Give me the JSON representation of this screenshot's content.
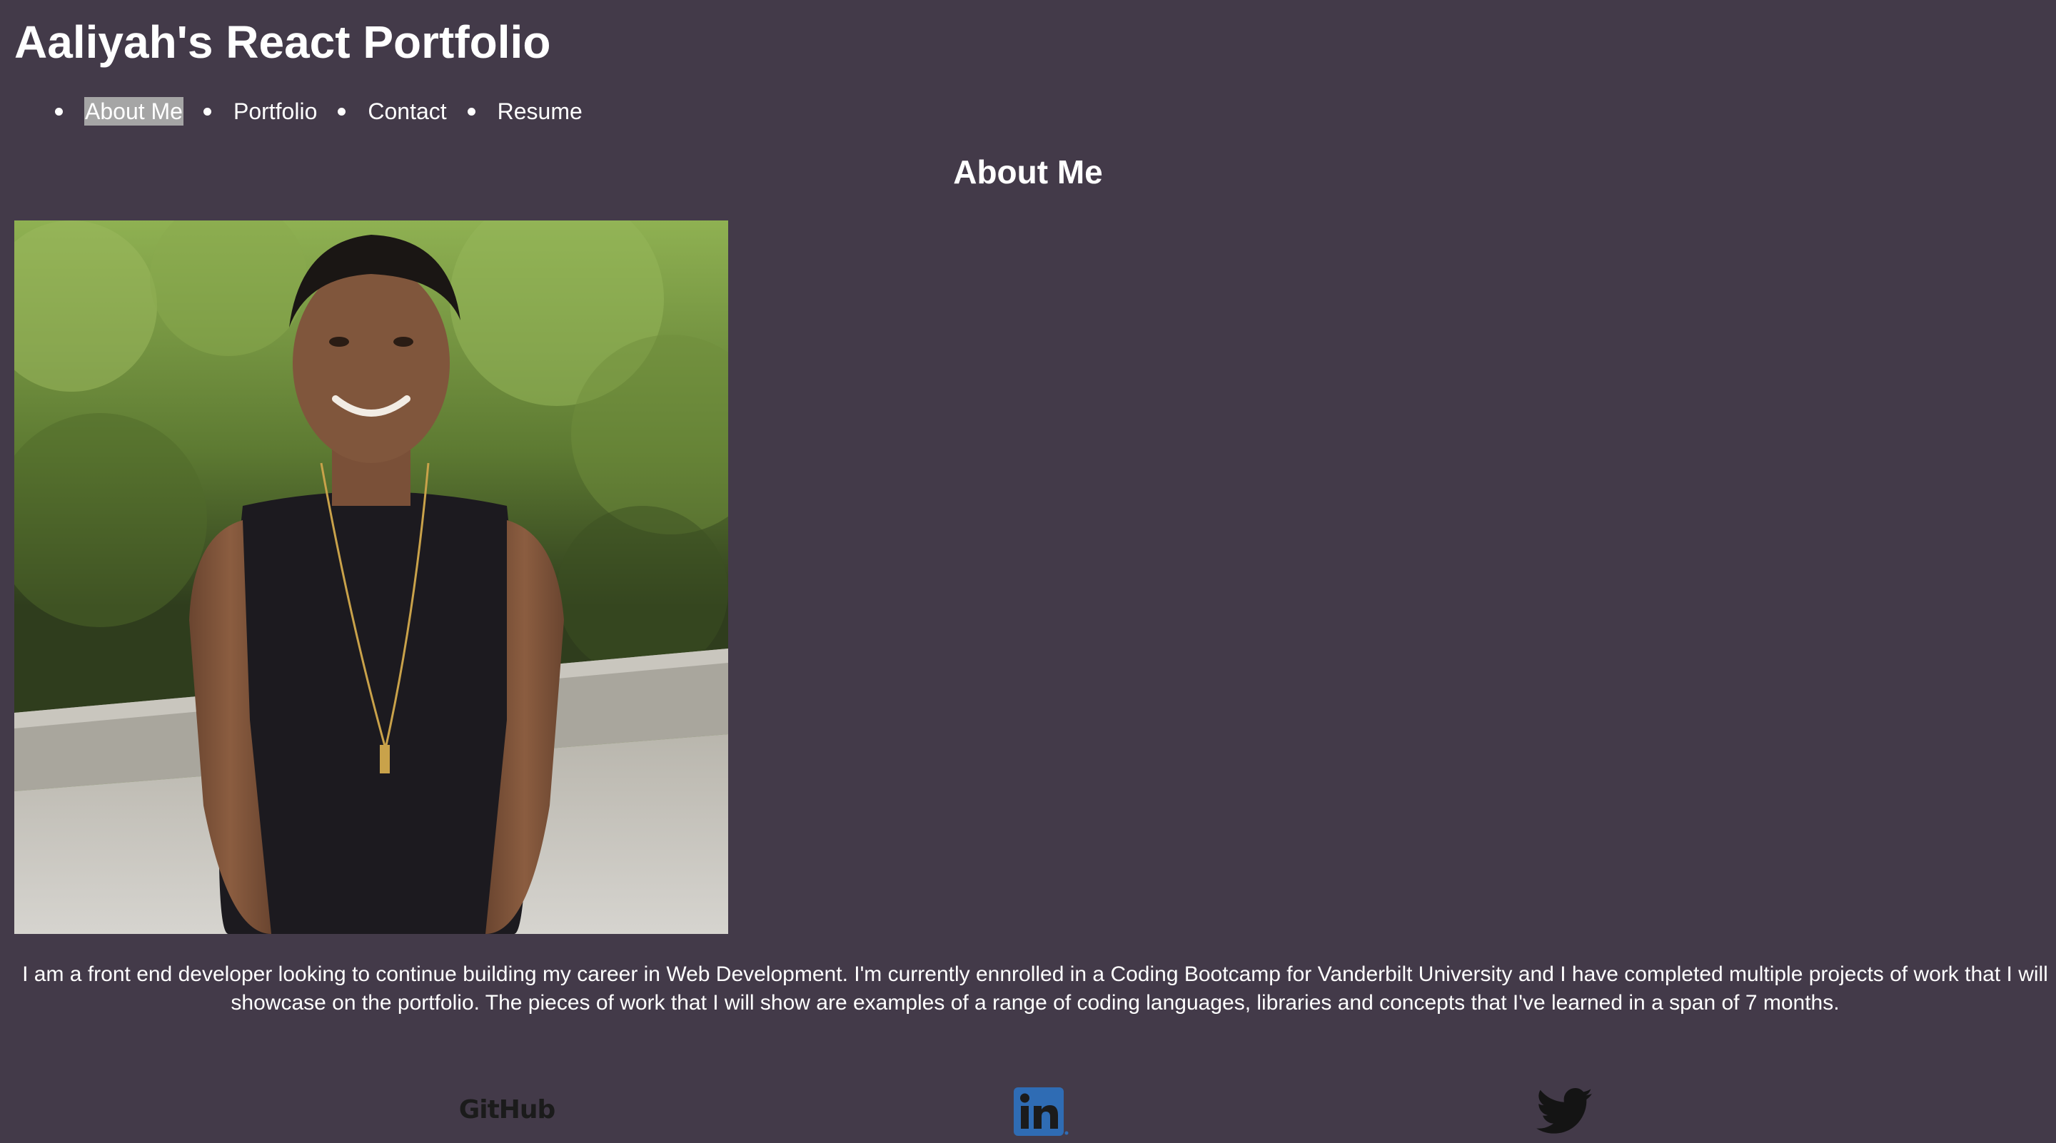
{
  "header": {
    "title": "Aaliyah's React Portfolio"
  },
  "nav": {
    "items": [
      {
        "label": "About Me",
        "active": true
      },
      {
        "label": "Portfolio",
        "active": false
      },
      {
        "label": "Contact",
        "active": false
      },
      {
        "label": "Resume",
        "active": false
      }
    ],
    "active_highlight_color": "#a5a5a5"
  },
  "about": {
    "heading": "About Me",
    "photo_icon": "profile-photo",
    "bio": "I am a front end developer looking to continue building my career in Web Development. I'm currently ennrolled in a Coding Bootcamp for Vanderbilt University and I have completed multiple projects of work that I will showcase on the portfolio. The pieces of work that I will show are examples of a range of coding languages, libraries and concepts that I've learned in a span of 7 months."
  },
  "footer": {
    "social": [
      {
        "name": "GitHub",
        "icon": "github-icon"
      },
      {
        "name": "LinkedIn",
        "icon": "linkedin-icon"
      },
      {
        "name": "Twitter",
        "icon": "twitter-icon"
      }
    ]
  },
  "colors": {
    "background": "#433a49",
    "text": "#ffffff",
    "linkedin_blue": "#2f6cb4"
  }
}
